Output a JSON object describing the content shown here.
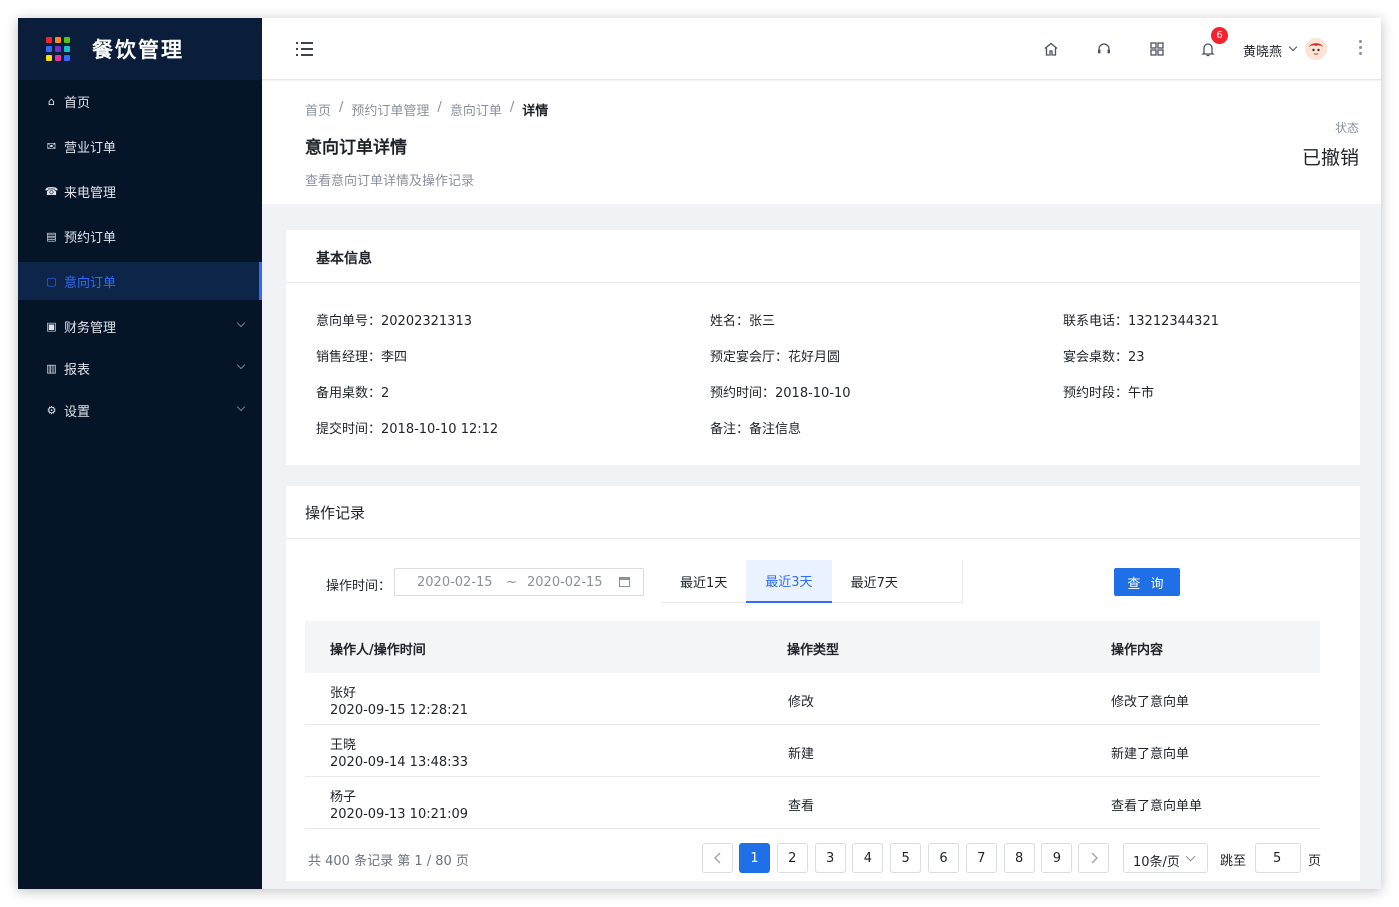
{
  "app": {
    "title": "餐饮管理",
    "logo_colors": [
      "#f5222d",
      "#fa8c16",
      "#52c41a",
      "#2f6bff",
      "#722ed1",
      "#13c2c2",
      "#fadb14",
      "#eb2f96",
      "#2f6bff"
    ]
  },
  "sidebar": {
    "items": [
      {
        "label": "首页",
        "icon": "home-icon"
      },
      {
        "label": "营业订单",
        "icon": "mail-icon"
      },
      {
        "label": "来电管理",
        "icon": "phone-icon"
      },
      {
        "label": "预约订单",
        "icon": "calendar-icon"
      },
      {
        "label": "意向订单",
        "icon": "tablet-icon",
        "active": true
      },
      {
        "label": "财务管理",
        "icon": "finance-icon",
        "expandable": true
      },
      {
        "label": "报表",
        "icon": "chart-icon",
        "expandable": true
      },
      {
        "label": "设置",
        "icon": "gear-icon",
        "expandable": true
      }
    ]
  },
  "topbar": {
    "icons": [
      "menu-icon",
      "home-icon",
      "headset-icon",
      "grid-icon",
      "bell-icon"
    ],
    "notification_count": "6",
    "user_name": "黄晓燕"
  },
  "header": {
    "breadcrumb": [
      "首页",
      "预约订单管理",
      "意向订单",
      "详情"
    ],
    "title": "意向订单详情",
    "description": "查看意向订单详情及操作记录",
    "status_label": "状态",
    "status_value": "已撤销"
  },
  "basic_info": {
    "title": "基本信息",
    "fields": [
      {
        "label": "意向单号：",
        "value": "20202321313"
      },
      {
        "label": "姓名：",
        "value": "张三"
      },
      {
        "label": "联系电话：",
        "value": "13212344321"
      },
      {
        "label": "销售经理：",
        "value": "李四"
      },
      {
        "label": "预定宴会厅：",
        "value": "花好月圆"
      },
      {
        "label": "宴会桌数：",
        "value": "23"
      },
      {
        "label": "备用桌数：",
        "value": "2"
      },
      {
        "label": "预约时间：",
        "value": "2018-10-10"
      },
      {
        "label": "预约时段：",
        "value": "午市"
      },
      {
        "label": "提交时间：",
        "value": "2018-10-10 12:12"
      },
      {
        "label": "备注：",
        "value": "备注信息"
      }
    ]
  },
  "records": {
    "title": "操作记录",
    "filter_label": "操作时间：",
    "date_from": "2020-02-15",
    "date_sep": "~",
    "date_to": "2020-02-15",
    "tabs": [
      "最近1天",
      "最近3天",
      "最近7天"
    ],
    "active_tab": 1,
    "query_button": "查 询",
    "columns": [
      "操作人/操作时间",
      "操作类型",
      "操作内容"
    ],
    "rows": [
      {
        "operator": "张好",
        "time": "2020-09-15 12:28:21",
        "type": "修改",
        "content": "修改了意向单"
      },
      {
        "operator": "王晓",
        "time": "2020-09-14 13:48:33",
        "type": "新建",
        "content": "新建了意向单"
      },
      {
        "operator": "杨子",
        "time": "2020-09-13 10:21:09",
        "type": "查看",
        "content": "查看了意向单单"
      }
    ]
  },
  "pagination": {
    "summary": "共 400 条记录 第 1 / 80 页",
    "pages": [
      "1",
      "2",
      "3",
      "4",
      "5",
      "6",
      "7",
      "8",
      "9"
    ],
    "current": "1",
    "page_size": "10条/页",
    "jump_label": "跳至",
    "jump_value": "5",
    "page_label": "页"
  }
}
